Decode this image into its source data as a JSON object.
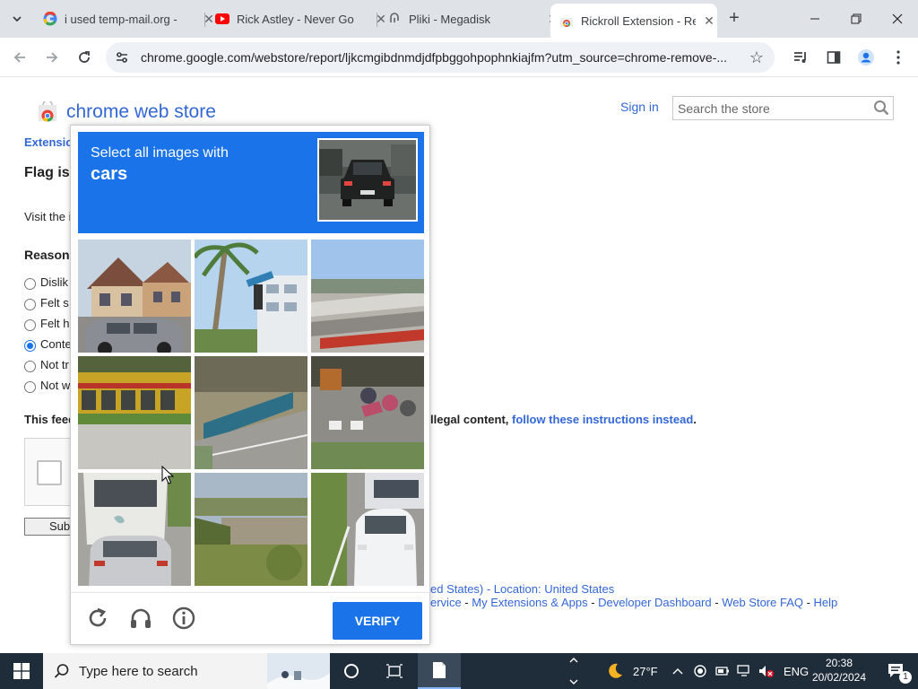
{
  "browser": {
    "tabs": [
      {
        "label": "i used temp-mail.org -",
        "icon": "google-icon",
        "active": false
      },
      {
        "label": "Rick Astley - Never Go",
        "icon": "youtube-icon",
        "active": false
      },
      {
        "label": "Pliki - Megadisk",
        "icon": "link-icon",
        "active": false
      },
      {
        "label": "Rickroll Extension - Re",
        "icon": "chrome-web-store-icon",
        "active": true
      }
    ],
    "url": "chrome.google.com/webstore/report/ljkcmgibdnmdjdfpbggohpophnkiajfm?utm_source=chrome-remove-..."
  },
  "page": {
    "store_title": "chrome web store",
    "sign_in": "Sign in",
    "search_placeholder": "Search the store",
    "breadcrumb": "Extensio",
    "heading": "Flag is",
    "visit_text": "Visit the i",
    "reason_label": "Reason",
    "radios": [
      {
        "label": "Dislik",
        "checked": false
      },
      {
        "label": "Felt s",
        "checked": false
      },
      {
        "label": "Felt h",
        "checked": false
      },
      {
        "label": "Conte",
        "checked": true
      },
      {
        "label": "Not tr",
        "checked": false
      },
      {
        "label": "Not w",
        "checked": false
      }
    ],
    "feedback_text": "This feed",
    "illegal_prefix": "llegal content, ",
    "illegal_link": "follow these instructions instead",
    "illegal_suffix": ".",
    "submit_label": "Subr",
    "footer": {
      "region_tail": "ed States) - Location: ",
      "location": "United States",
      "service": "ervice",
      "sep": " - ",
      "links": [
        "My Extensions & Apps",
        "Developer Dashboard",
        "Web Store FAQ",
        "Help"
      ]
    }
  },
  "captcha": {
    "instruction": "Select all images with",
    "object": "cars",
    "verify_label": "VERIFY",
    "tiles": [
      "house-with-car",
      "palm-trees-street",
      "bridge-overpass",
      "tram",
      "bridge-railing",
      "motorcycles-crosswalk",
      "bus-and-car",
      "hillside-wall",
      "white-car-road"
    ]
  },
  "taskbar": {
    "search_placeholder": "Type here to search",
    "weather": "27°F",
    "language": "ENG",
    "time": "20:38",
    "date": "20/02/2024",
    "notifications": "1"
  }
}
